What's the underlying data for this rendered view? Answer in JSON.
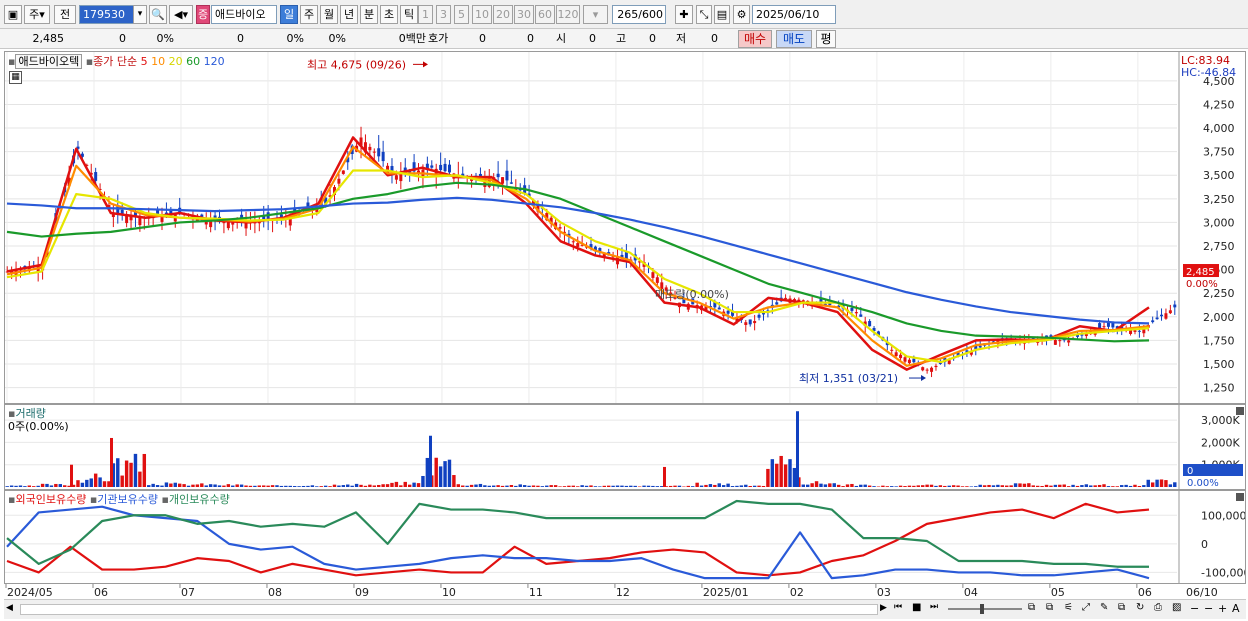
{
  "toolbar": {
    "type_label": "주",
    "prev_label": "전",
    "code": "179530",
    "badge": "증",
    "stock_name": "애드바이오",
    "periods": [
      "일",
      "주",
      "월",
      "년",
      "분",
      "초",
      "틱"
    ],
    "period_selected": "일",
    "intervals": [
      "1",
      "3",
      "5",
      "10",
      "20",
      "30",
      "60",
      "120"
    ],
    "count": "265",
    "count_max": "/600",
    "date": "2025/06/10"
  },
  "quote": {
    "price": "2,485",
    "change": "0",
    "change_pct": "0%",
    "volume": "0",
    "vol_pct": "0%",
    "v2_pct": "0%",
    "amount": "0백만",
    "hoga_label": "호가",
    "hoga1": "0",
    "hoga2": "0",
    "open_label": "시",
    "open": "0",
    "high_label": "고",
    "high": "0",
    "low_label": "저",
    "low": "0",
    "buy_label": "매수",
    "sell_label": "매도",
    "eval_label": "평"
  },
  "price_pane": {
    "stock_tag": "애드바이오텍",
    "ma_title": "종가 단순",
    "ma_periods": [
      "5",
      "10",
      "20",
      "60",
      "120"
    ],
    "ma_colors": [
      "#e01010",
      "#ff8c00",
      "#e6e600",
      "#1a9a2a",
      "#2a5ad8"
    ],
    "lc": "LC:83.94",
    "hc": "HC:-46.84",
    "current_price_tag": "2,485",
    "current_pct_tag": "0.00%",
    "high_note": "최고 4,675 (09/26)",
    "low_note": "최저 1,351 (03/21)",
    "ratio_note": "매도량(0.00%)"
  },
  "volume_pane": {
    "title": "거래량",
    "value": "0주(0.00%)",
    "tag_value": "0",
    "tag_pct": "0.00%"
  },
  "holding_pane": {
    "series": [
      {
        "name": "외국인보유수량",
        "color": "#e01010"
      },
      {
        "name": "기관보유수량",
        "color": "#2a5ad8"
      },
      {
        "name": "개인보유수량",
        "color": "#2a8a5a"
      }
    ]
  },
  "chart_data": [
    {
      "type": "candlestick",
      "title": "",
      "yticks": [
        "4,500",
        "4,250",
        "4,000",
        "3,750",
        "3,500",
        "3,250",
        "3,000",
        "2,750",
        "2,500",
        "2,250",
        "2,000",
        "1,750",
        "1,500",
        "1,250"
      ],
      "ylim": [
        1150,
        4700
      ],
      "x_ticks": [
        "2024/05",
        "06",
        "07",
        "08",
        "09",
        "10",
        "11",
        "12",
        "2025/01",
        "02",
        "03",
        "04",
        "05",
        "06",
        "06/10"
      ],
      "series": [
        {
          "name": "5",
          "values": [
            2480,
            2550,
            3780,
            3100,
            3050,
            3100,
            3020,
            3000,
            3050,
            3200,
            3900,
            3500,
            3580,
            3480,
            3480,
            3200,
            2800,
            2650,
            2580,
            2150,
            2100,
            1920,
            2200,
            2150,
            2050,
            1650,
            1440,
            1600,
            1750,
            1760,
            1750,
            1900,
            1850,
            2100
          ]
        },
        {
          "name": "10",
          "values": [
            2450,
            2520,
            3600,
            3200,
            3080,
            3050,
            3030,
            3010,
            3040,
            3150,
            3800,
            3520,
            3520,
            3490,
            3450,
            3250,
            2900,
            2700,
            2600,
            2250,
            2150,
            1980,
            2100,
            2150,
            2100,
            1750,
            1480,
            1560,
            1700,
            1740,
            1760,
            1850,
            1860,
            1900
          ]
        },
        {
          "name": "20",
          "values": [
            2420,
            2480,
            3300,
            3250,
            3100,
            3050,
            3040,
            3020,
            3030,
            3100,
            3550,
            3550,
            3480,
            3500,
            3420,
            3300,
            3000,
            2800,
            2680,
            2400,
            2250,
            2050,
            2050,
            2150,
            2150,
            1850,
            1580,
            1520,
            1650,
            1720,
            1750,
            1820,
            1850,
            1880
          ]
        },
        {
          "name": "60",
          "values": [
            2900,
            2850,
            2880,
            2900,
            2950,
            3000,
            3020,
            3050,
            3100,
            3150,
            3250,
            3300,
            3380,
            3420,
            3400,
            3350,
            3250,
            3100,
            2950,
            2800,
            2650,
            2500,
            2350,
            2250,
            2150,
            2050,
            1930,
            1850,
            1800,
            1790,
            1780,
            1760,
            1740,
            1750
          ]
        },
        {
          "name": "120",
          "values": [
            3200,
            3180,
            3150,
            3150,
            3140,
            3130,
            3120,
            3130,
            3140,
            3170,
            3200,
            3210,
            3240,
            3260,
            3240,
            3200,
            3160,
            3100,
            3030,
            2950,
            2860,
            2760,
            2660,
            2560,
            2460,
            2360,
            2260,
            2180,
            2110,
            2050,
            2010,
            1970,
            1940,
            1930
          ]
        }
      ],
      "high_value": 4675,
      "low_value": 1351
    },
    {
      "type": "bar",
      "title": "거래량",
      "yticks": [
        "3,000K",
        "2,000K",
        "1,000K"
      ],
      "ylim": [
        0,
        3500
      ],
      "values_k": [
        100,
        220,
        900,
        2200,
        300,
        250,
        200,
        120,
        150,
        180,
        200,
        350,
        2300,
        250,
        180,
        150,
        120,
        110,
        100,
        90,
        300,
        150,
        2000,
        400,
        200,
        100,
        180,
        120,
        150,
        250,
        180,
        200,
        150,
        500
      ]
    },
    {
      "type": "line",
      "title": "",
      "yticks": [
        "100,000",
        "0",
        "-100,000"
      ],
      "ylim": [
        -130000,
        150000
      ],
      "series": [
        {
          "name": "외국인보유수량",
          "values": [
            -60000,
            -100000,
            -10000,
            -90000,
            -90000,
            -80000,
            -50000,
            -60000,
            -100000,
            -70000,
            -90000,
            -110000,
            -100000,
            -90000,
            -100000,
            -100000,
            -10000,
            -70000,
            -60000,
            -50000,
            -30000,
            -20000,
            -30000,
            -100000,
            -110000,
            -100000,
            -60000,
            -40000,
            10000,
            70000,
            90000,
            110000,
            120000,
            90000,
            140000,
            110000,
            120000
          ]
        },
        {
          "name": "기관보유수량",
          "values": [
            -10000,
            110000,
            120000,
            130000,
            100000,
            90000,
            80000,
            0,
            -20000,
            -10000,
            -70000,
            -90000,
            -80000,
            -70000,
            -50000,
            -40000,
            -50000,
            -50000,
            -60000,
            -60000,
            -50000,
            -90000,
            -120000,
            -120000,
            -120000,
            40000,
            -120000,
            -110000,
            -90000,
            -90000,
            -100000,
            -100000,
            -110000,
            -110000,
            -100000,
            -90000,
            -120000
          ]
        },
        {
          "name": "개인보유수량",
          "values": [
            20000,
            -70000,
            -20000,
            80000,
            100000,
            100000,
            70000,
            80000,
            60000,
            70000,
            60000,
            110000,
            0,
            140000,
            120000,
            120000,
            110000,
            90000,
            90000,
            90000,
            90000,
            90000,
            90000,
            150000,
            140000,
            140000,
            120000,
            20000,
            20000,
            10000,
            -60000,
            -60000,
            -60000,
            -70000,
            -70000,
            -80000,
            -80000
          ]
        }
      ]
    }
  ]
}
